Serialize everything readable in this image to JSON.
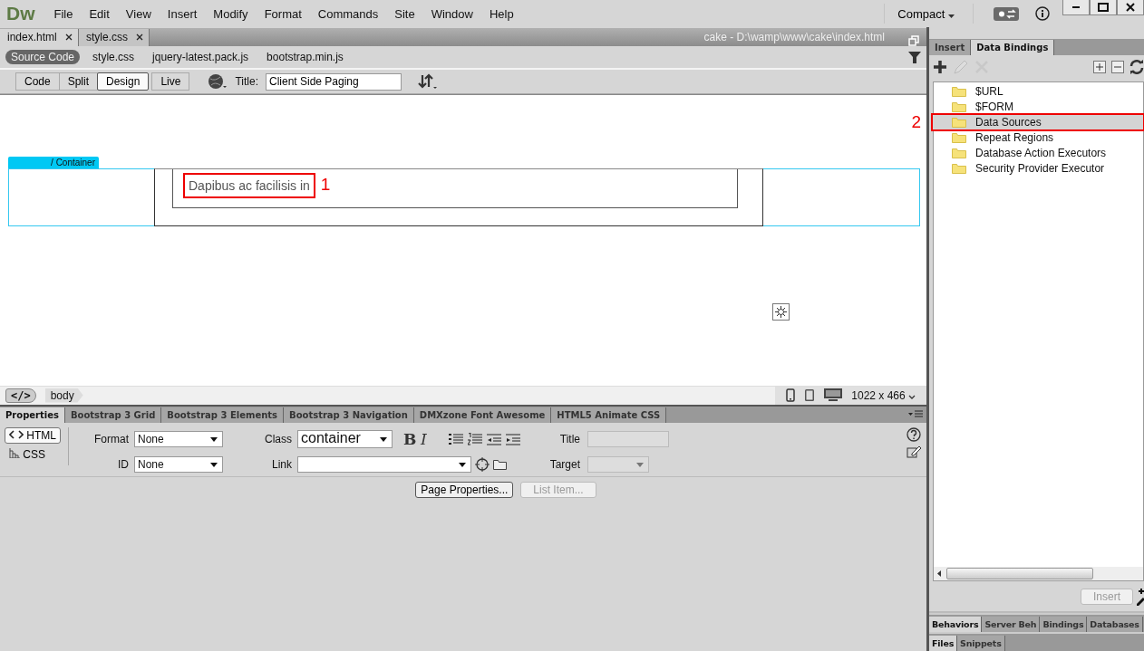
{
  "app": {
    "logo": "Dw",
    "workspace": "Compact"
  },
  "menu": [
    "File",
    "Edit",
    "View",
    "Insert",
    "Modify",
    "Format",
    "Commands",
    "Site",
    "Window",
    "Help"
  ],
  "document_tabs": [
    {
      "label": "index.html",
      "selected": true
    },
    {
      "label": "style.css",
      "selected": false
    }
  ],
  "document_path": "cake - D:\\wamp\\www\\cake\\index.html",
  "related_files": [
    {
      "label": "Source Code",
      "selected": true
    },
    {
      "label": "style.css",
      "selected": false
    },
    {
      "label": "jquery-latest.pack.js",
      "selected": false
    },
    {
      "label": "bootstrap.min.js",
      "selected": false
    }
  ],
  "view_buttons": [
    {
      "label": "Code",
      "selected": false
    },
    {
      "label": "Split",
      "selected": false
    },
    {
      "label": "Design",
      "selected": true
    },
    {
      "label": "Live",
      "selected": false
    }
  ],
  "title_field": {
    "label": "Title:",
    "value": "Client Side Paging"
  },
  "canvas": {
    "container_label": "/ Container",
    "text": "Dapibus ac facilisis in",
    "callout": "1"
  },
  "tag_selector": {
    "code_marker": "</>",
    "tags": [
      "body"
    ],
    "window_size": "1022 x 466"
  },
  "property_tabs": [
    {
      "label": "Properties",
      "selected": true
    },
    {
      "label": "Bootstrap 3 Grid",
      "selected": false
    },
    {
      "label": "Bootstrap 3 Elements",
      "selected": false
    },
    {
      "label": "Bootstrap 3 Navigation",
      "selected": false
    },
    {
      "label": "DMXzone Font Awesome",
      "selected": false
    },
    {
      "label": "HTML5 Animate CSS",
      "selected": false
    }
  ],
  "properties": {
    "html_button": {
      "label": "HTML",
      "selected": true
    },
    "css_button": {
      "label": "CSS",
      "selected": false
    },
    "format_label": "Format",
    "format_value": "None",
    "id_label": "ID",
    "id_value": "None",
    "class_label": "Class",
    "class_value": "container",
    "link_label": "Link",
    "bold": "B",
    "italic": "I",
    "title_label": "Title",
    "target_label": "Target",
    "page_properties": {
      "label": "Page Properties...",
      "disabled": false
    },
    "list_item": {
      "label": "List Item...",
      "disabled": true
    }
  },
  "panel": {
    "tabs": [
      {
        "label": "Insert",
        "selected": false
      },
      {
        "label": "Data Bindings",
        "selected": true
      }
    ],
    "items": [
      {
        "label": "$URL",
        "selected": false
      },
      {
        "label": "$FORM",
        "selected": false
      },
      {
        "label": "Data Sources",
        "selected": true
      },
      {
        "label": "Repeat Regions",
        "selected": false
      },
      {
        "label": "Database Action Executors",
        "selected": false
      },
      {
        "label": "Security Provider Executor",
        "selected": false
      }
    ],
    "callout": "2",
    "insert_button": {
      "label": "Insert",
      "disabled": true
    },
    "bottom_tabs": [
      {
        "label": "Behaviors",
        "selected": true
      },
      {
        "label": "Server Beh",
        "selected": false
      },
      {
        "label": "Bindings",
        "selected": false
      },
      {
        "label": "Databases",
        "selected": false
      }
    ],
    "file_tabs": [
      {
        "label": "Files",
        "selected": true
      },
      {
        "label": "Snippets",
        "selected": false
      }
    ]
  }
}
